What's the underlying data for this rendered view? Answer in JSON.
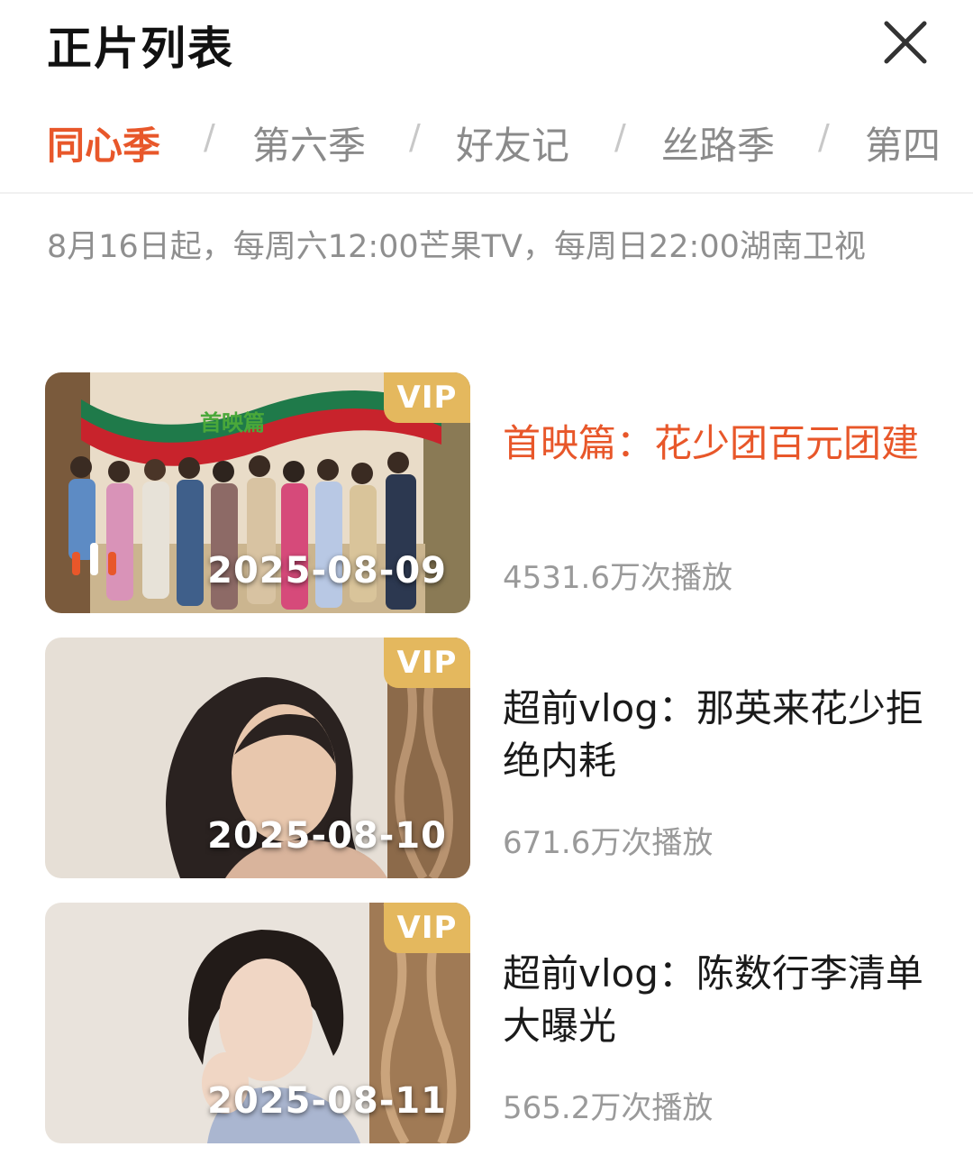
{
  "header": {
    "title": "正片列表",
    "close_icon": "close-icon"
  },
  "tabs": [
    {
      "label": "同心季",
      "active": true
    },
    {
      "label": "第六季",
      "active": false
    },
    {
      "label": "好友记",
      "active": false
    },
    {
      "label": "丝路季",
      "active": false
    },
    {
      "label": "第四",
      "active": false
    }
  ],
  "separator": "/",
  "schedule": "8月16日起，每周六12:00芒果TV，每周日22:00湖南卫视",
  "episodes": [
    {
      "title": "首映篇：花少团百元团建",
      "plays": "4531.6万次播放",
      "date": "2025-08-09",
      "badge": "VIP",
      "playing": true,
      "banner_text": "首映篇"
    },
    {
      "title": "超前vlog：那英来花少拒绝内耗",
      "plays": "671.6万次播放",
      "date": "2025-08-10",
      "badge": "VIP",
      "playing": false
    },
    {
      "title": "超前vlog：陈数行李清单大曝光",
      "plays": "565.2万次播放",
      "date": "2025-08-11",
      "badge": "VIP",
      "playing": false
    }
  ],
  "colors": {
    "accent": "#e8572a",
    "vip": "#e4b85e",
    "muted": "#8f8f8f"
  }
}
